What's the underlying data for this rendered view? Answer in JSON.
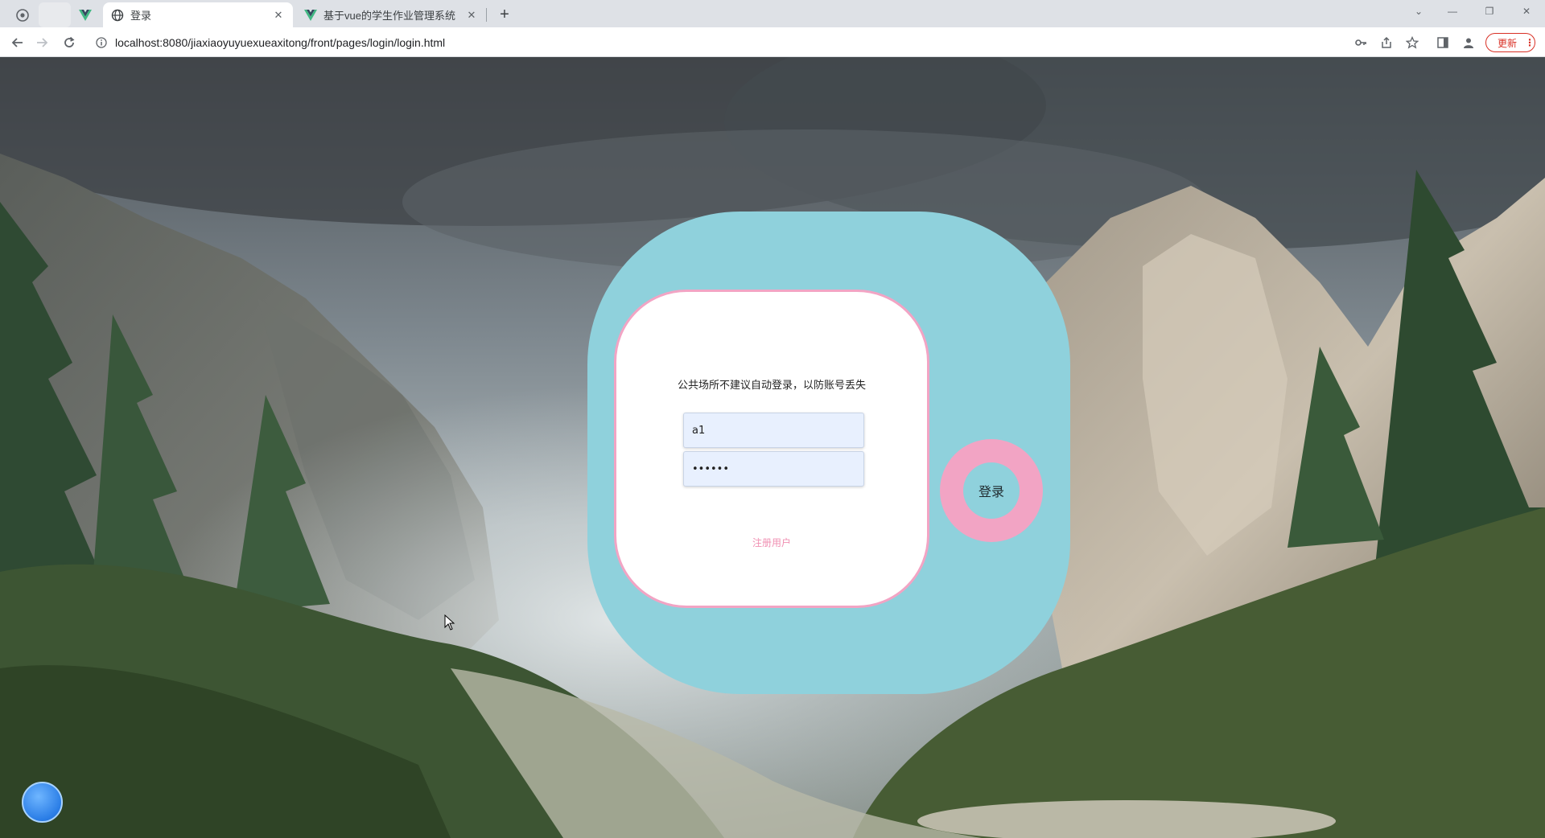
{
  "browser": {
    "tabs": [
      {
        "title": "登录",
        "active": true
      },
      {
        "title": "基于vue的学生作业管理系统",
        "active": false
      }
    ],
    "new_tab": "+",
    "url": "localhost:8080/jiaxiaoyuyuexueaxitong/front/pages/login/login.html",
    "update_label": "更新",
    "menu_glyph": "⋮"
  },
  "login": {
    "notice": "公共场所不建议自动登录，以防账号丢失",
    "username_value": "a1",
    "password_value": "••••••",
    "register_label": "注册用户",
    "login_button": "登录"
  },
  "colors": {
    "panel_teal": "#8fd1dc",
    "accent_pink": "#f2a4c4",
    "card_white": "#ffffff"
  },
  "icons": {
    "tab_pinned_1": "chrome-icon",
    "tab_pinned_2": "vue-icon",
    "tab_active": "globe-icon",
    "tab_2": "vue-icon",
    "float_ball": "floating-ball-icon"
  }
}
